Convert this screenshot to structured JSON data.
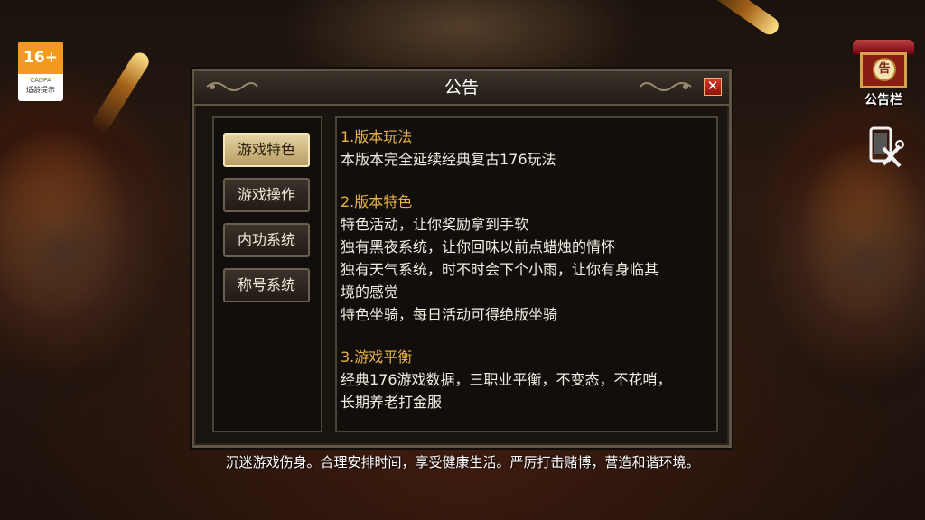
{
  "age_rating": {
    "age": "16+",
    "org": "CADPA",
    "tip": "适龄提示"
  },
  "notice_button": {
    "seal": "告",
    "label": "公告栏"
  },
  "dialog": {
    "title": "公告",
    "close_label": "✕",
    "tabs": [
      {
        "label": "游戏特色",
        "active": true
      },
      {
        "label": "游戏操作",
        "active": false
      },
      {
        "label": "内功系统",
        "active": false
      },
      {
        "label": "称号系统",
        "active": false
      }
    ],
    "sections": [
      {
        "heading": "1.版本玩法",
        "lines": [
          "本版本完全延续经典复古176玩法"
        ]
      },
      {
        "heading": "2.版本特色",
        "lines": [
          "特色活动，让你奖励拿到手软",
          "独有黑夜系统，让你回味以前点蜡烛的情怀",
          "独有天气系统，时不时会下个小雨，让你有身临其",
          "境的感觉",
          "特色坐骑，每日活动可得绝版坐骑"
        ]
      },
      {
        "heading": "3.游戏平衡",
        "lines": [
          "经典176游戏数据，三职业平衡，不变态，不花哨，",
          "长期养老打金服"
        ]
      }
    ]
  },
  "footer": "沉迷游戏伤身。合理安排时间，享受健康生活。严厉打击赌博，营造和谐环境。",
  "colors": {
    "heading": "#e7b14a",
    "active_tab": "#d6c38f",
    "close": "#c0261a"
  }
}
